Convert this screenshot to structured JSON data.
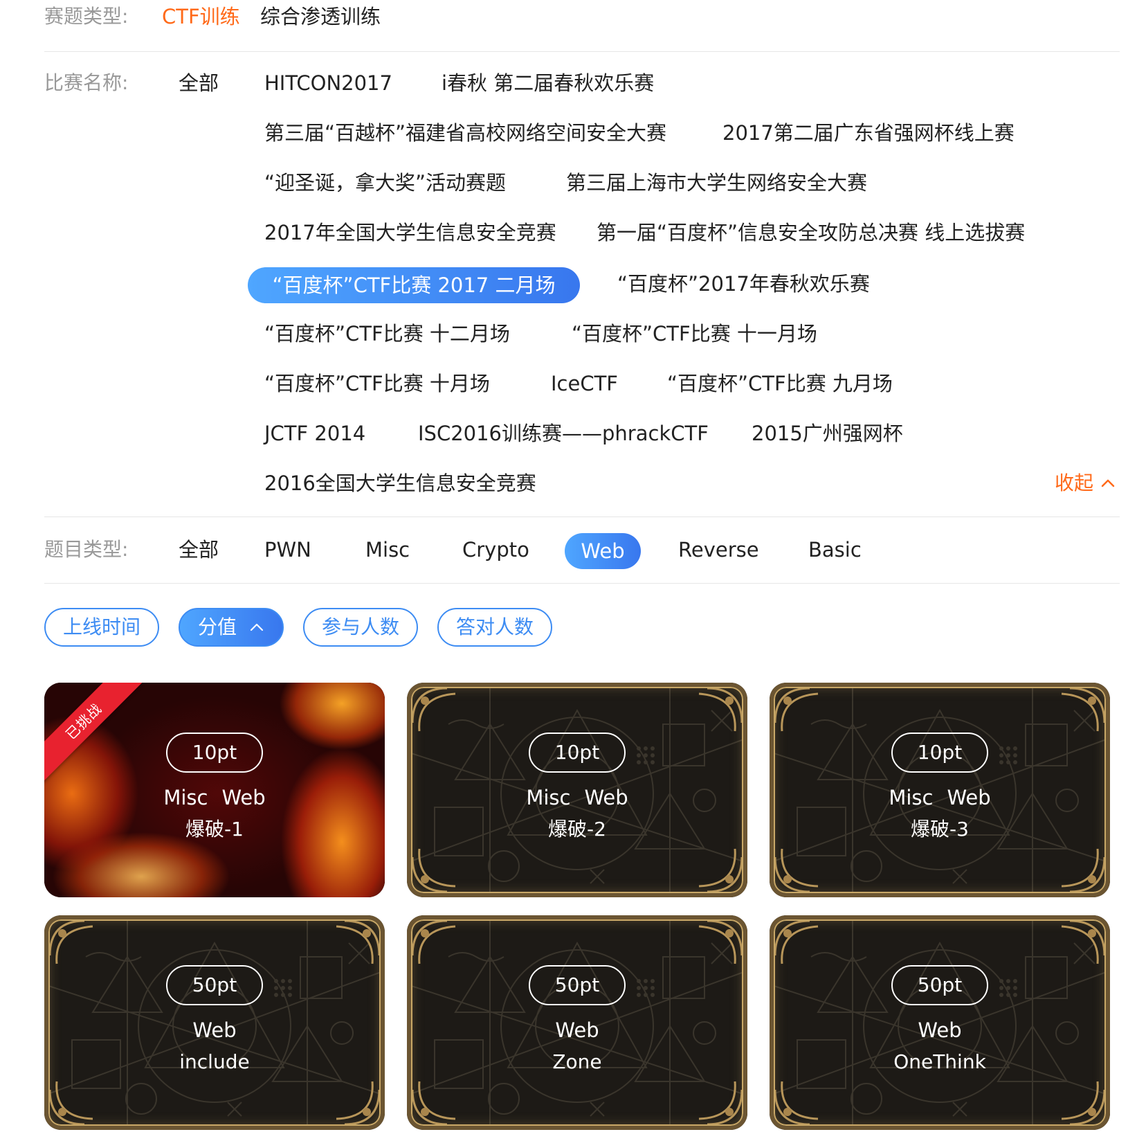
{
  "filters": {
    "category": {
      "label": "赛题类型:",
      "options": [
        "CTF训练",
        "综合渗透训练"
      ],
      "selected": "CTF训练"
    },
    "competition": {
      "label": "比赛名称:",
      "options": [
        "全部",
        "HITCON2017",
        "i春秋 第二届春秋欢乐赛",
        "第三届“百越杯”福建省高校网络空间安全大赛",
        "2017第二届广东省强网杯线上赛",
        "“迎圣诞，拿大奖”活动赛题",
        "第三届上海市大学生网络安全大赛",
        "2017年全国大学生信息安全竞赛",
        "第一届“百度杯”信息安全攻防总决赛 线上选拔赛",
        "“百度杯”CTF比赛 2017 二月场",
        "“百度杯”2017年春秋欢乐赛",
        "“百度杯”CTF比赛 十二月场",
        "“百度杯”CTF比赛 十一月场",
        "“百度杯”CTF比赛 十月场",
        "IceCTF",
        "“百度杯”CTF比赛 九月场",
        "JCTF 2014",
        "ISC2016训练赛——phrackCTF",
        "2015广州强网杯",
        "2016全国大学生信息安全竞赛"
      ],
      "selected": "“百度杯”CTF比赛 2017 二月场",
      "collapse_label": "收起"
    },
    "type": {
      "label": "题目类型:",
      "options": [
        "全部",
        "PWN",
        "Misc",
        "Crypto",
        "Web",
        "Reverse",
        "Basic"
      ],
      "selected": "Web"
    }
  },
  "sort": {
    "buttons": [
      "上线时间",
      "分值",
      "参与人数",
      "答对人数"
    ],
    "active": "分值",
    "active_direction": "ascending"
  },
  "challenges": [
    {
      "points": "10pt",
      "tags": [
        "Misc",
        "Web"
      ],
      "title": "爆破-1",
      "theme": "fire",
      "badge": "已挑战"
    },
    {
      "points": "10pt",
      "tags": [
        "Misc",
        "Web"
      ],
      "title": "爆破-2",
      "theme": "dark"
    },
    {
      "points": "10pt",
      "tags": [
        "Misc",
        "Web"
      ],
      "title": "爆破-3",
      "theme": "dark"
    },
    {
      "points": "50pt",
      "tags": [
        "Web"
      ],
      "title": "include",
      "theme": "dark"
    },
    {
      "points": "50pt",
      "tags": [
        "Web"
      ],
      "title": "Zone",
      "theme": "dark"
    },
    {
      "points": "50pt",
      "tags": [
        "Web"
      ],
      "title": "OneThink",
      "theme": "dark"
    }
  ],
  "colors": {
    "accent_orange": "#ff6a1a",
    "accent_blue": "#3d8cf3",
    "label_gray": "#999999",
    "badge_red": "#e8222f",
    "card_gold": "#c9a867"
  }
}
